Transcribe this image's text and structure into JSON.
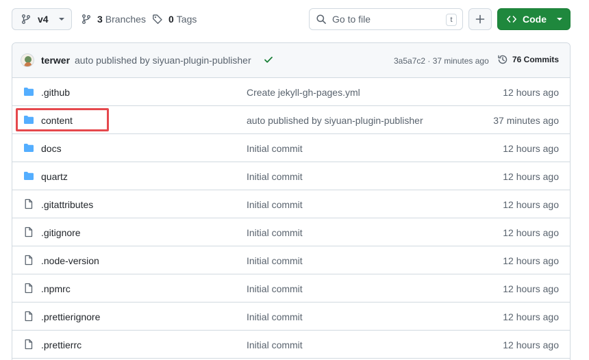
{
  "toolbar": {
    "branch": "v4",
    "branches_count": "3",
    "branches_label": "Branches",
    "tags_count": "0",
    "tags_label": "Tags",
    "search_placeholder": "Go to file",
    "search_shortcut": "t",
    "code_label": "Code"
  },
  "commit": {
    "author": "terwer",
    "message": "auto published by siyuan-plugin-publisher",
    "sha_time": "3a5a7c2 · 37 minutes ago",
    "commits_label": "76 Commits"
  },
  "files": [
    {
      "name": ".github",
      "type": "folder",
      "message": "Create jekyll-gh-pages.yml",
      "time": "12 hours ago"
    },
    {
      "name": "content",
      "type": "folder",
      "message": "auto published by siyuan-plugin-publisher",
      "time": "37 minutes ago"
    },
    {
      "name": "docs",
      "type": "folder",
      "message": "Initial commit",
      "time": "12 hours ago"
    },
    {
      "name": "quartz",
      "type": "folder",
      "message": "Initial commit",
      "time": "12 hours ago"
    },
    {
      "name": ".gitattributes",
      "type": "file",
      "message": "Initial commit",
      "time": "12 hours ago"
    },
    {
      "name": ".gitignore",
      "type": "file",
      "message": "Initial commit",
      "time": "12 hours ago"
    },
    {
      "name": ".node-version",
      "type": "file",
      "message": "Initial commit",
      "time": "12 hours ago"
    },
    {
      "name": ".npmrc",
      "type": "file",
      "message": "Initial commit",
      "time": "12 hours ago"
    },
    {
      "name": ".prettierignore",
      "type": "file",
      "message": "Initial commit",
      "time": "12 hours ago"
    },
    {
      "name": ".prettierrc",
      "type": "file",
      "message": "Initial commit",
      "time": "12 hours ago"
    }
  ],
  "colors": {
    "folder": "#54aeff",
    "code_button": "#1f883d",
    "highlight": "#e5484d",
    "check": "#1a7f37"
  },
  "icons": {
    "branch": "git-branch-icon",
    "tag": "tag-icon",
    "search": "search-icon",
    "history": "history-icon",
    "folder": "folder-icon",
    "file": "file-icon"
  }
}
